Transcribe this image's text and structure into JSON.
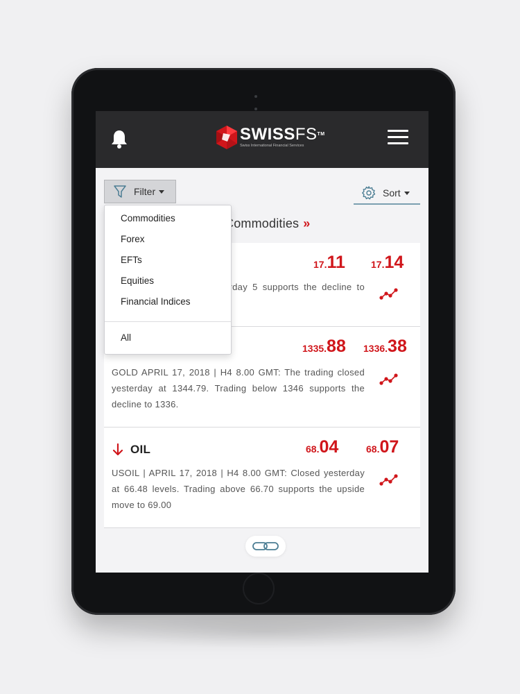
{
  "header": {
    "logo": {
      "name_bold": "SWISS",
      "name_light": "FS",
      "tm": "TM",
      "subtitle": "Swiss International Financial Services"
    },
    "icons": {
      "left": "bell-icon",
      "right": "hamburger-menu-icon"
    }
  },
  "toolbar": {
    "filter_label": "Filter",
    "sort_label": "Sort"
  },
  "section": {
    "title": "Commodities",
    "chevron": "»"
  },
  "filter_menu": {
    "items": [
      "Commodities",
      "Forex",
      "EFTs",
      "Equities",
      "Financial Indices"
    ],
    "footer_item": "All"
  },
  "cards": [
    {
      "name": "",
      "bid_small": "17.",
      "bid_big": "11",
      "ask_small": "17.",
      "ask_big": "14",
      "description": "4 8.00 GMT: Closed yesterday 5 supports the decline to 16.35."
    },
    {
      "name": "",
      "bid_small": "1335.",
      "bid_big": "88",
      "ask_small": "1336.",
      "ask_big": "38",
      "description": "GOLD APRIL 17, 2018 | H4 8.00 GMT: The trading closed yesterday at 1344.79. Trading below 1346 supports the decline to 1336."
    },
    {
      "name": "OIL",
      "bid_small": "68.",
      "bid_big": "04",
      "ask_small": "68.",
      "ask_big": "07",
      "description": "USOIL | APRIL 17, 2018 | H4 8.00 GMT: Closed yesterday at 66.48 levels. Trading above 66.70 supports the upside move to 69.00"
    }
  ],
  "colors": {
    "accent": "#d0161b",
    "header_bg": "#2a2a2c",
    "sort_underline": "#7a9fb0"
  }
}
